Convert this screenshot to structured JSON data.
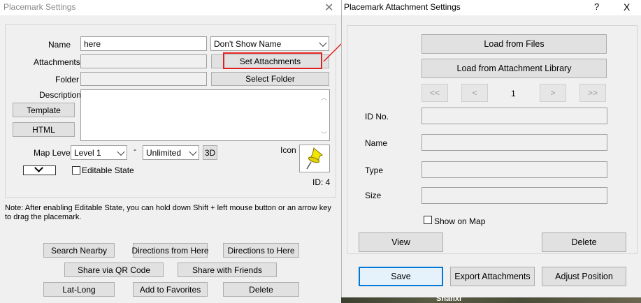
{
  "left_window": {
    "title": "Placemark Settings",
    "name_label": "Name",
    "name_value": "here",
    "name_display_select": "Don't Show Name",
    "attachments_label": "Attachments",
    "set_attachments_button": "Set Attachments",
    "folder_label": "Folder",
    "select_folder_button": "Select Folder",
    "description_label": "Description",
    "template_button": "Template",
    "html_button": "HTML",
    "map_level_label": "Map Level",
    "map_level_from": "Level 1",
    "range_separator": "-",
    "map_level_to": "Unlimited",
    "btn_3d": "3D",
    "icon_label": "Icon",
    "editable_state_label": "Editable State",
    "id_text": "ID: 4",
    "note": "Note: After enabling Editable State, you can hold down Shift + left mouse button or an arrow key to drag the placemark.",
    "actions": {
      "search_nearby": "Search Nearby",
      "directions_from_here": "Directions from Here",
      "directions_to_here": "Directions to Here",
      "share_via_qr": "Share via QR Code",
      "share_with_friends": "Share with Friends",
      "lat_long": "Lat-Long",
      "add_to_favorites": "Add to Favorites",
      "delete": "Delete"
    }
  },
  "right_window": {
    "title": "Placemark Attachment Settings",
    "help_glyph": "?",
    "close_glyph": "X",
    "load_from_files": "Load from Files",
    "load_from_library": "Load from Attachment Library",
    "nav_first": "<<",
    "nav_prev": "<",
    "page_number": "1",
    "nav_next": ">",
    "nav_last": ">>",
    "id_no_label": "ID No.",
    "name_label": "Name",
    "type_label": "Type",
    "size_label": "Size",
    "show_on_map_label": "Show on Map",
    "view_button": "View",
    "delete_button": "Delete",
    "save_button": "Save",
    "export_attachments_button": "Export Attachments",
    "adjust_position_button": "Adjust Position"
  },
  "background_map_label": "Shanxi",
  "highlight_color": "#e02020"
}
